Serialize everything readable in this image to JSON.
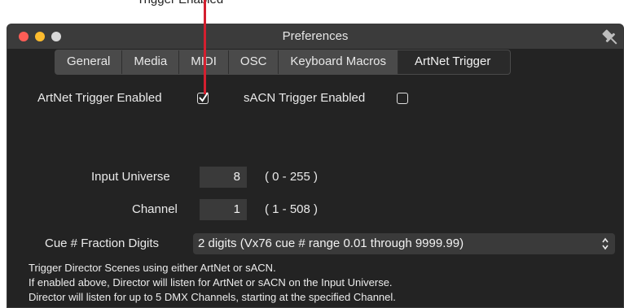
{
  "callout": {
    "text": "Trigger Enabled"
  },
  "window": {
    "title": "Preferences"
  },
  "tabs": [
    {
      "label": "General"
    },
    {
      "label": "Media"
    },
    {
      "label": "MIDI"
    },
    {
      "label": "OSC"
    },
    {
      "label": "Keyboard Macros"
    },
    {
      "label": "ArtNet Trigger",
      "active": true
    }
  ],
  "artnet": {
    "label": "ArtNet Trigger Enabled",
    "checked": true
  },
  "sacn": {
    "label": "sACN Trigger Enabled",
    "checked": false
  },
  "input_universe": {
    "label": "Input Universe",
    "value": "8",
    "range": "( 0 - 255 )"
  },
  "channel": {
    "label": "Channel",
    "value": "1",
    "range": "( 1 - 508 )"
  },
  "cue_fraction": {
    "label": "Cue # Fraction Digits",
    "selected": "2 digits (Vx76 cue # range 0.01 through 9999.99)"
  },
  "help_lines": [
    "Trigger Director Scenes using either ArtNet or sACN.",
    "If enabled above, Director will listen for ArtNet or sACN on the Input Universe.",
    "Director will listen for up to 5 DMX Channels, starting at the specified Channel."
  ],
  "colors": {
    "accent_red": "#d41f2f",
    "window_bg": "#232323"
  }
}
